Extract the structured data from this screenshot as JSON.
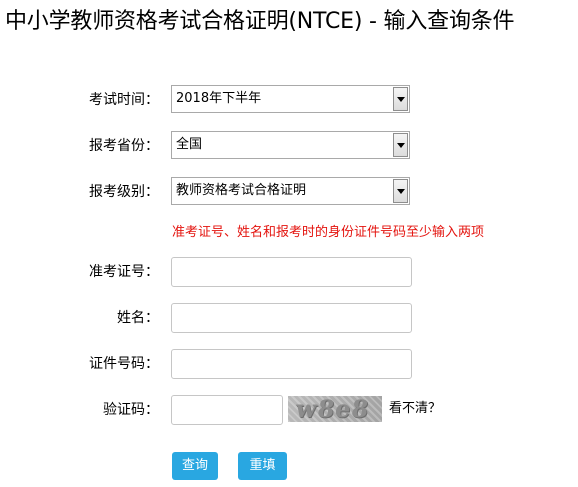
{
  "page": {
    "title": "中小学教师资格考试合格证明(NTCE) - 输入查询条件"
  },
  "form": {
    "exam_time": {
      "label": "考试时间：",
      "selected": "2018年下半年"
    },
    "province": {
      "label": "报考省份：",
      "selected": "全国"
    },
    "level": {
      "label": "报考级别：",
      "selected": "教师资格考试合格证明"
    },
    "hint": "准考证号、姓名和报考时的身份证件号码至少输入两项",
    "admission_no": {
      "label": "准考证号：",
      "value": ""
    },
    "name": {
      "label": "姓名：",
      "value": ""
    },
    "id_no": {
      "label": "证件号码：",
      "value": ""
    },
    "captcha": {
      "label": "验证码：",
      "value": "",
      "image_text": "w8e8",
      "refresh_text": "看不清？"
    },
    "buttons": {
      "query": "查询",
      "reset": "重填"
    }
  },
  "colors": {
    "button_bg": "#29a7e1",
    "hint_color": "#e4140f"
  },
  "icons": {
    "dropdown": "chevron-down-icon"
  }
}
